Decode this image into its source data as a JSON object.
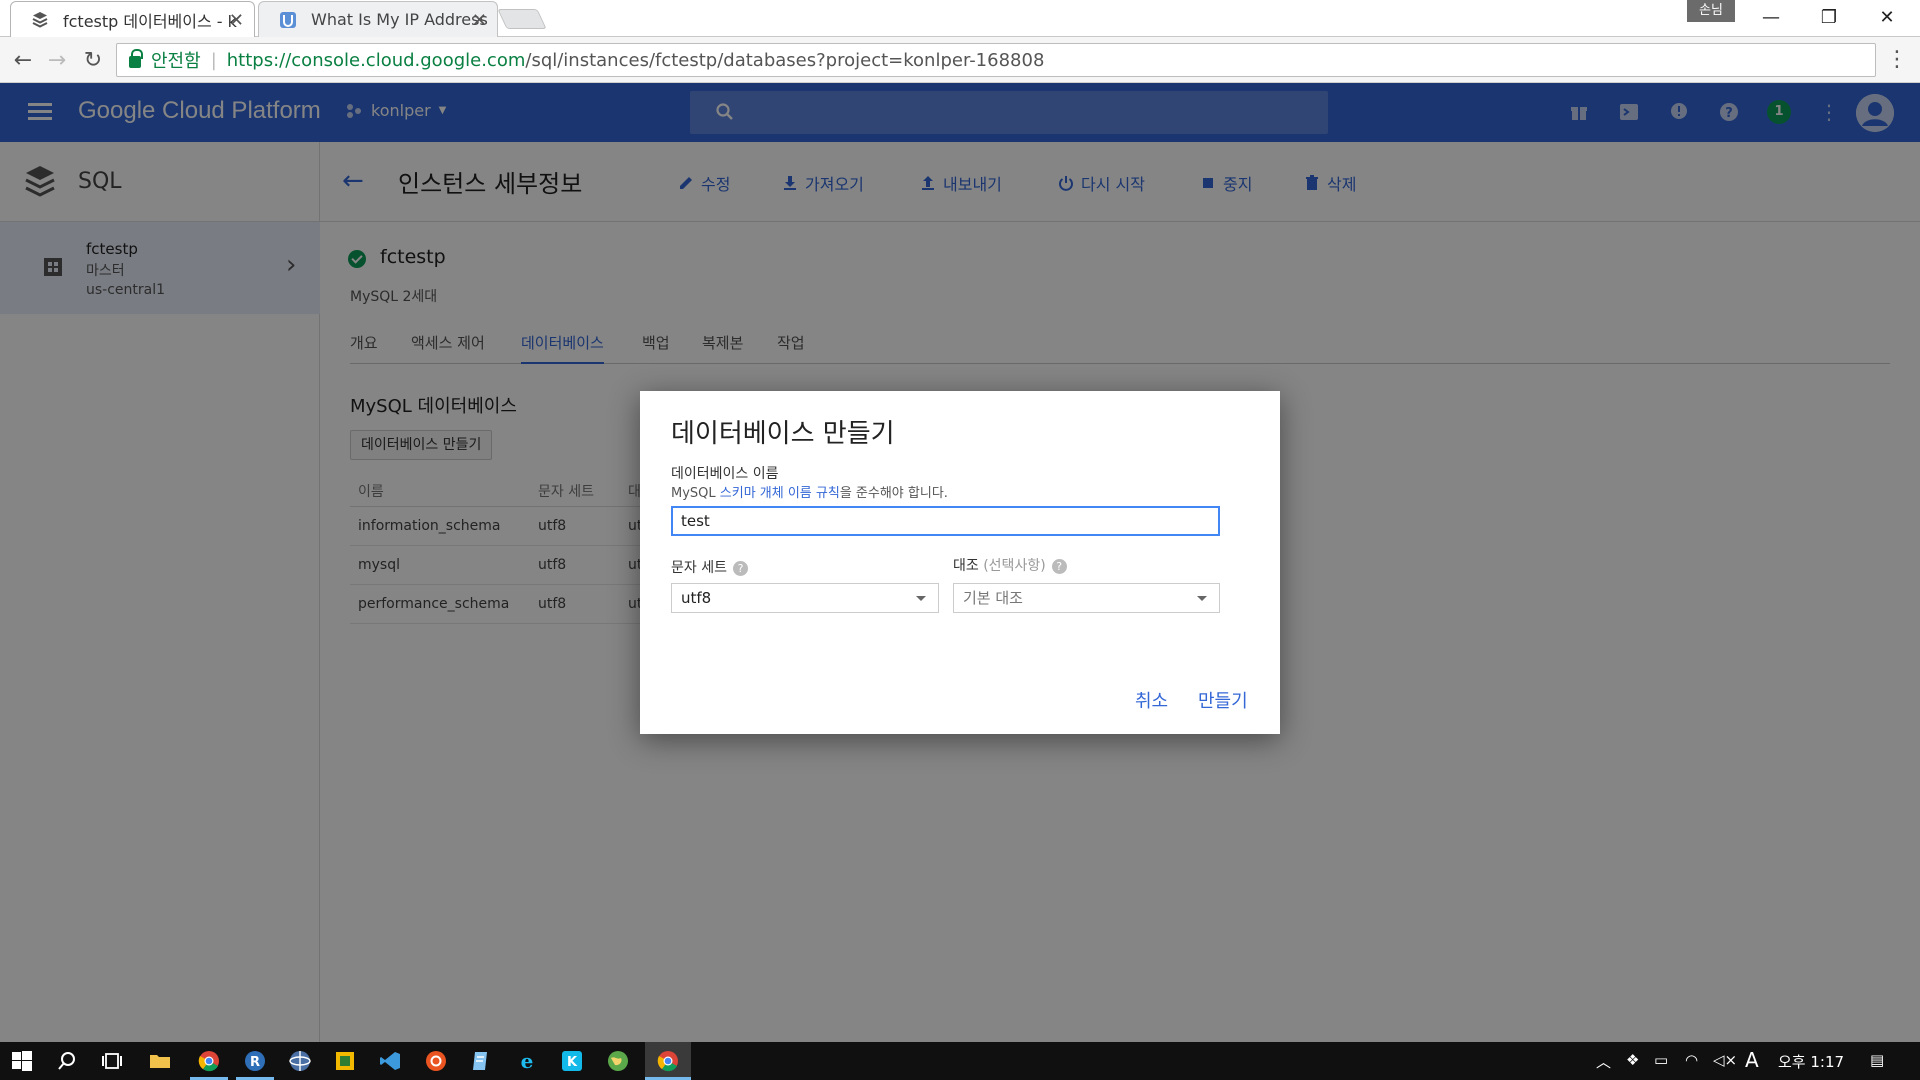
{
  "browser": {
    "tabs": [
      {
        "title": "fctestp 데이터베이스 - k",
        "active": true
      },
      {
        "title": "What Is My IP Address",
        "active": false
      }
    ],
    "profile": "손님",
    "secure_label": "안전함",
    "url_host": "https://console.cloud.google.com",
    "url_path": "/sql/instances/fctestp/databases?project=konlper-168808"
  },
  "header": {
    "brand": "Google Cloud Platform",
    "project": "konlper",
    "notifications": "1"
  },
  "sidebar": {
    "title": "SQL",
    "instance": {
      "name": "fctestp",
      "role": "마스터",
      "region": "us-central1"
    }
  },
  "page": {
    "title": "인스턴스 세부정보",
    "actions": {
      "edit": "수정",
      "import": "가져오기",
      "export": "내보내기",
      "restart": "다시 시작",
      "stop": "중지",
      "delete": "삭제"
    },
    "instance_name": "fctestp",
    "instance_type": "MySQL 2세대",
    "tabs": [
      "개요",
      "액세스 제어",
      "데이터베이스",
      "백업",
      "복제본",
      "작업"
    ],
    "active_tab": "데이터베이스"
  },
  "databases": {
    "title": "MySQL 데이터베이스",
    "create_button": "데이터베이스 만들기",
    "columns": [
      "이름",
      "문자 세트",
      "대"
    ],
    "rows": [
      {
        "name": "information_schema",
        "charset": "utf8",
        "collation": "ut"
      },
      {
        "name": "mysql",
        "charset": "utf8",
        "collation": "ut"
      },
      {
        "name": "performance_schema",
        "charset": "utf8",
        "collation": "ut"
      }
    ]
  },
  "dialog": {
    "title": "데이터베이스 만들기",
    "name_label": "데이터베이스 이름",
    "hint_prefix": "MySQL ",
    "hint_link": "스키마 개체 이름 규칙",
    "hint_suffix": "을 준수해야 합니다.",
    "name_value": "test",
    "charset_label": "문자 세트",
    "charset_value": "utf8",
    "collation_label": "대조",
    "collation_optional": "(선택사항)",
    "collation_placeholder": "기본 대조",
    "cancel": "취소",
    "create": "만들기"
  },
  "taskbar": {
    "clock": "오후 1:17",
    "ime": "A"
  },
  "colors": {
    "gcp_blue": "#3367d6",
    "link_blue": "#3367d6",
    "status_green": "#0f9d58",
    "taskbar": "#101010"
  }
}
